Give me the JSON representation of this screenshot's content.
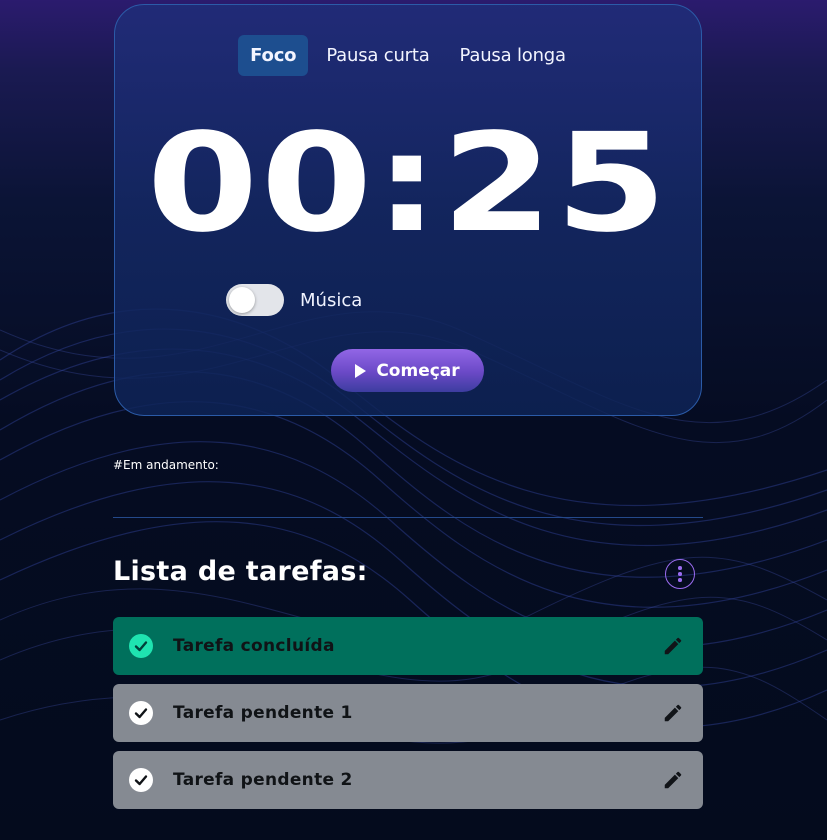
{
  "timer": {
    "tabs": [
      {
        "label": "Foco",
        "active": true
      },
      {
        "label": "Pausa curta",
        "active": false
      },
      {
        "label": "Pausa longa",
        "active": false
      }
    ],
    "time": "00:25",
    "music_label": "Música",
    "music_enabled": false,
    "start_label": "Começar"
  },
  "in_progress_label": "#Em andamento:",
  "tasks": {
    "title": "Lista de tarefas:",
    "items": [
      {
        "label": "Tarefa concluída",
        "status": "done"
      },
      {
        "label": "Tarefa pendente 1",
        "status": "pending"
      },
      {
        "label": "Tarefa pendente 2",
        "status": "pending"
      }
    ]
  },
  "icons": {
    "play": "play-icon",
    "menu": "more-vertical-icon",
    "check": "check-icon",
    "edit": "pencil-icon"
  },
  "colors": {
    "accent_purple": "#9a6cf0",
    "done_bg": "#00705c",
    "done_check": "#1fe3b0",
    "pending_bg": "#858a92",
    "active_tab_bg": "#1d4e8f"
  }
}
